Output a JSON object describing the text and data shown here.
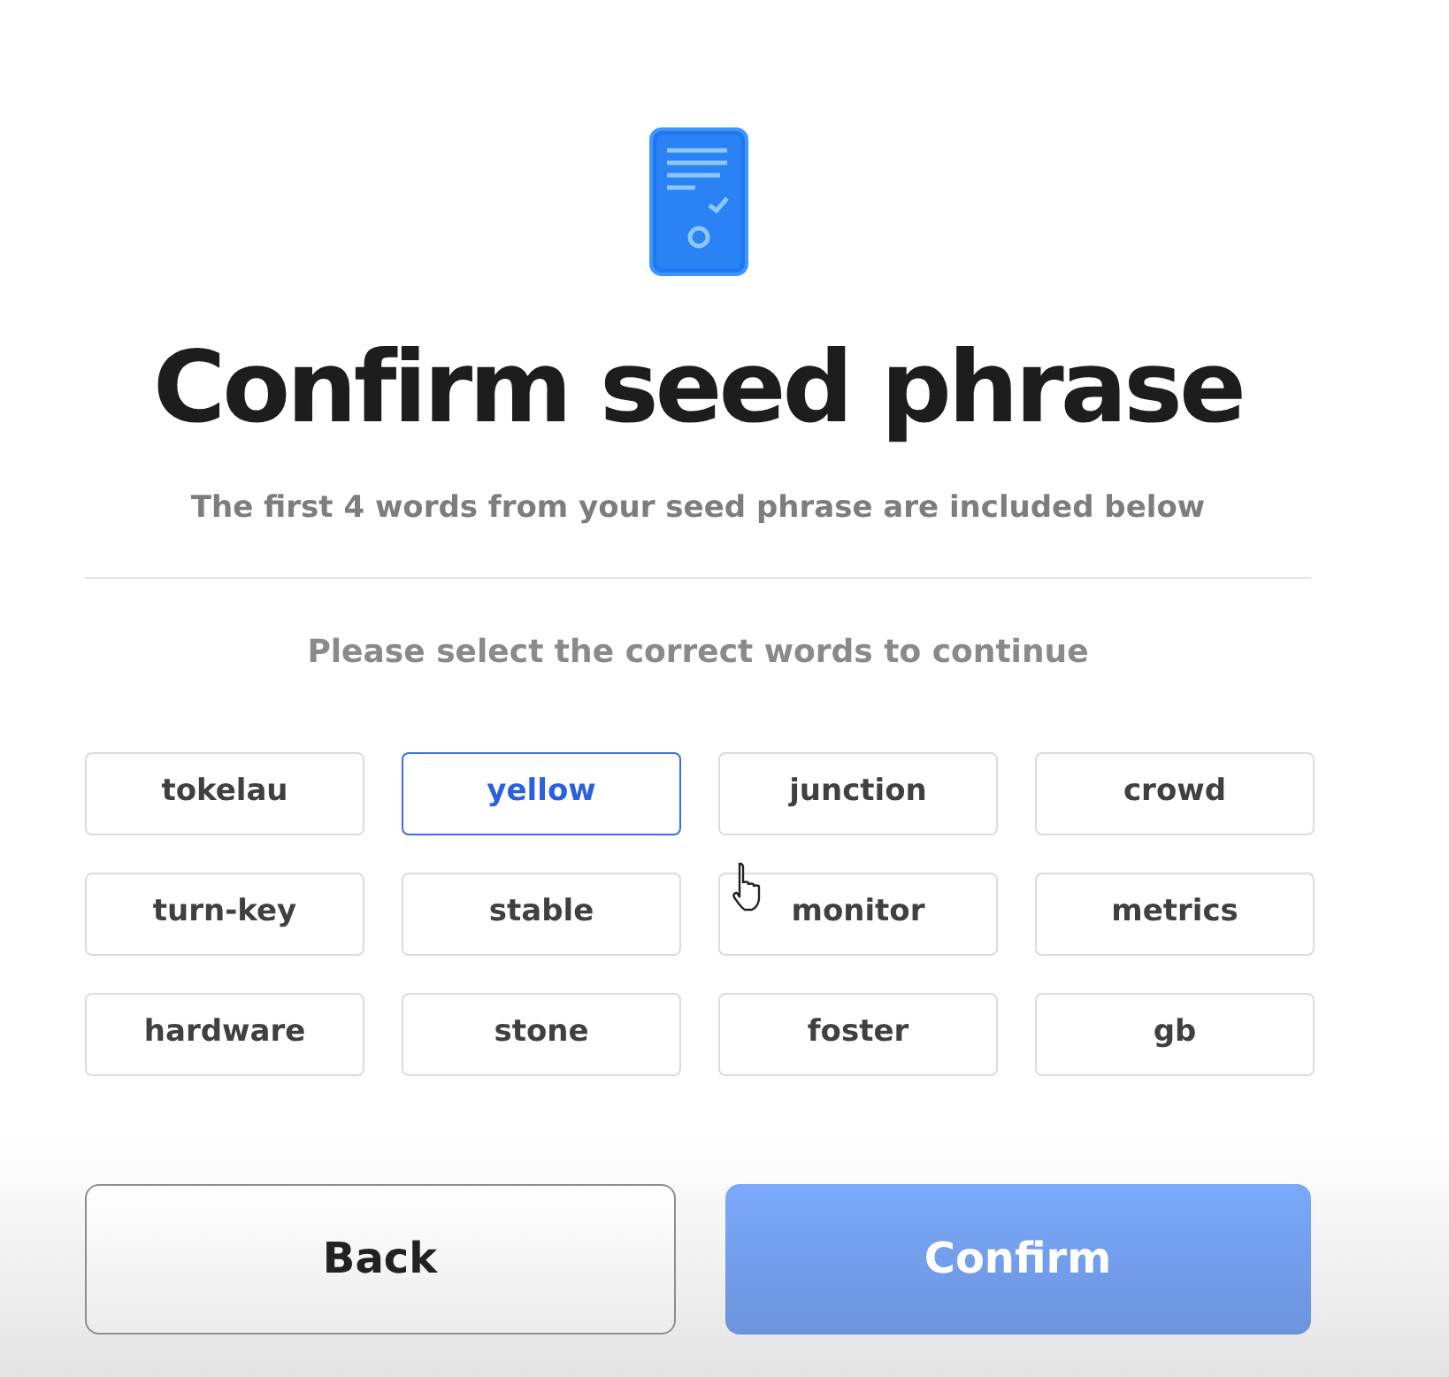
{
  "title": "Confirm seed phrase",
  "subtitle": "The first 4 words from your seed phrase are included below",
  "instruction": "Please select the correct words to continue",
  "words": [
    {
      "label": "tokelau",
      "selected": false
    },
    {
      "label": "yellow",
      "selected": true
    },
    {
      "label": "junction",
      "selected": false
    },
    {
      "label": "crowd",
      "selected": false
    },
    {
      "label": "turn-key",
      "selected": false
    },
    {
      "label": "stable",
      "selected": false
    },
    {
      "label": "monitor",
      "selected": false
    },
    {
      "label": "metrics",
      "selected": false
    },
    {
      "label": "hardware",
      "selected": false
    },
    {
      "label": "stone",
      "selected": false
    },
    {
      "label": "foster",
      "selected": false
    },
    {
      "label": "gb",
      "selected": false
    }
  ],
  "buttons": [
    {
      "label": "Back",
      "kind": "secondary",
      "disabled": false
    },
    {
      "label": "Confirm",
      "kind": "primary",
      "disabled": true
    }
  ]
}
